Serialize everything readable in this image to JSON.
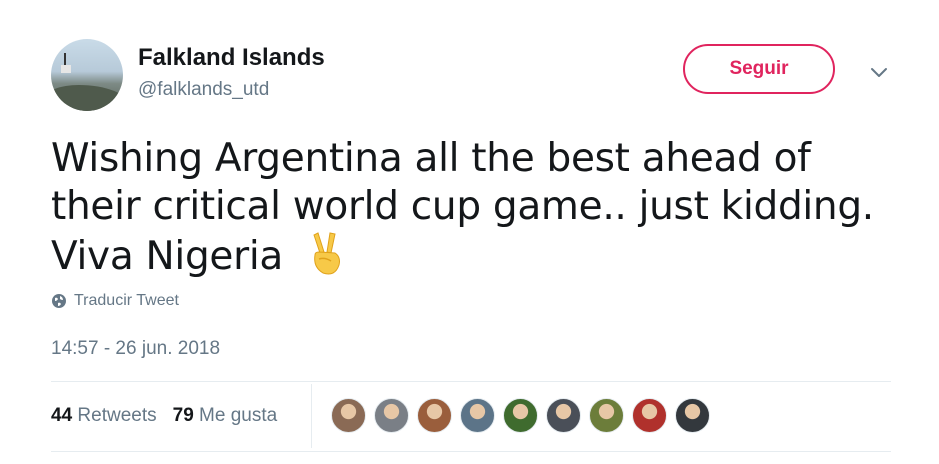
{
  "author": {
    "name": "Falkland Islands",
    "handle": "@falklands_utd"
  },
  "follow_button": {
    "label": "Seguir"
  },
  "tweet": {
    "text": "Wishing Argentina all the best ahead of their critical world cup game.. just kidding. Viva Nigeria",
    "emoji": "✌️"
  },
  "translate": {
    "label": "Traducir Tweet",
    "icon": "globe-icon"
  },
  "timestamp": "14:57 - 26 jun. 2018",
  "stats": {
    "retweets_count": "44",
    "retweets_label": "Retweets",
    "likes_count": "79",
    "likes_label": "Me gusta"
  },
  "likers": [
    {
      "color": "#8a6a55"
    },
    {
      "color": "#7a7f86"
    },
    {
      "color": "#9a5e3c"
    },
    {
      "color": "#5c7488"
    },
    {
      "color": "#3f6b2e"
    },
    {
      "color": "#4a4f58"
    },
    {
      "color": "#6c7d3a"
    },
    {
      "color": "#b0312c"
    },
    {
      "color": "#33383d"
    }
  ],
  "colors": {
    "accent": "#e0245e",
    "text_primary": "#14171a",
    "text_secondary": "#657786",
    "divider": "#e6ecf0"
  }
}
